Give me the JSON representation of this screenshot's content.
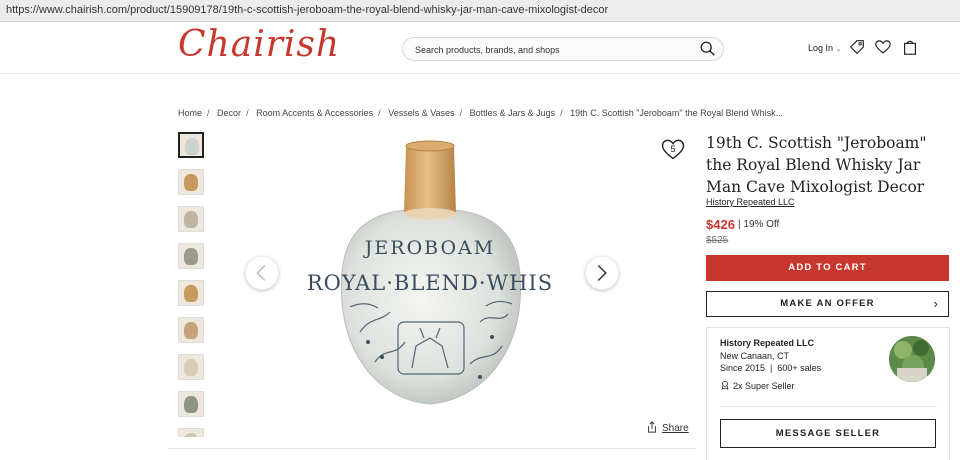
{
  "browser": {
    "url": "https://www.chairish.com/product/15909178/19th-c-scottish-jeroboam-the-royal-blend-whisky-jar-man-cave-mixologist-decor"
  },
  "header": {
    "logo": "Chairish",
    "search_placeholder": "Search products, brands, and shops",
    "login_label": "Log In",
    "icons": [
      "search-icon",
      "tag-icon",
      "heart-icon",
      "bag-icon"
    ]
  },
  "breadcrumb": [
    "Home",
    "Decor",
    "Room Accents & Accessories",
    "Vessels & Vases",
    "Bottles & Jars & Jugs",
    "19th C. Scottish \"Jeroboam\" the Royal Blend Whisk..."
  ],
  "gallery": {
    "thumbnail_count": 9,
    "jar_text_top": "JEROBOAM",
    "jar_text_main": "ROYAL·BLEND·WHIS",
    "favorite_count": "5",
    "share_label": "Share"
  },
  "product": {
    "title": "19th C. Scottish \"Jeroboam\" the Royal Blend Whisky Jar Man Cave Mixologist Decor",
    "seller_link": "History Repeated LLC",
    "price": "$426",
    "discount": "19% Off",
    "original_price": "$525",
    "add_to_cart": "ADD TO CART",
    "make_offer": "MAKE AN OFFER"
  },
  "seller": {
    "name": "History Repeated LLC",
    "location": "New Canaan, CT",
    "since": "Since 2015",
    "sales": "600+ sales",
    "badge": "2x Super Seller",
    "message_button": "MESSAGE SELLER"
  },
  "colors": {
    "brand_red": "#c8372d",
    "text": "#222222"
  }
}
